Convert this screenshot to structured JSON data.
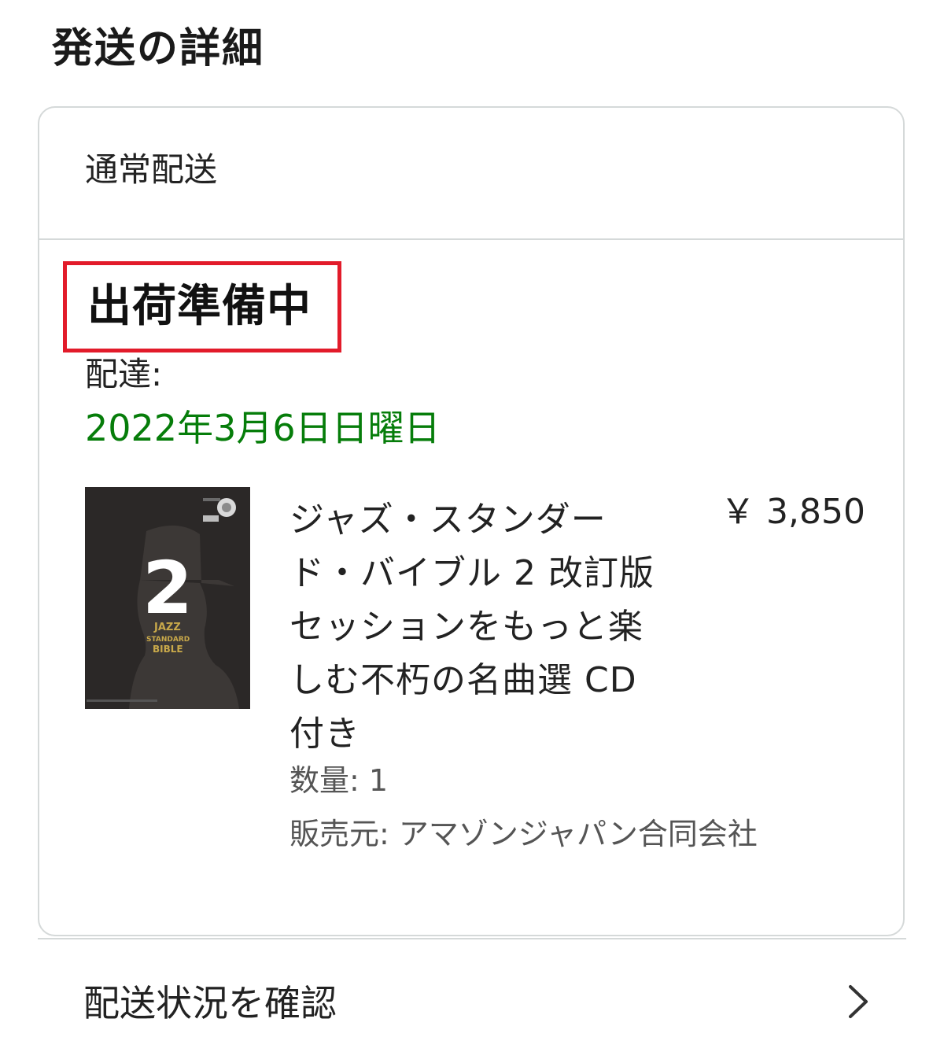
{
  "section": {
    "title": "発送の詳細"
  },
  "shipment": {
    "type": "通常配送",
    "status": "出荷準備中",
    "delivery_label": "配達:",
    "delivery_date": "2022年3月6日日曜日"
  },
  "item": {
    "title": "ジャズ・スタンダード・バイブル 2 改訂版 セッションをもっと楽しむ不朽の名曲選 CD付き",
    "price": "￥ 3,850",
    "quantity": "数量: 1",
    "seller": "販売元: アマゾンジャパン合同会社",
    "cover": {
      "number": "2",
      "text_lines": [
        "JAZZ",
        "STANDARD",
        "BIBLE"
      ],
      "colors": {
        "background": "#2b2827",
        "silhouette": "#3c3836",
        "number": "#ffffff",
        "title_text": "#c9a94a"
      }
    }
  },
  "tracking": {
    "label": "配送状況を確認",
    "icon": "chevron-right-icon"
  },
  "colors": {
    "highlight_border": "#e21b2a",
    "delivery_date": "#067d0a",
    "divider": "#d5d9d9"
  }
}
